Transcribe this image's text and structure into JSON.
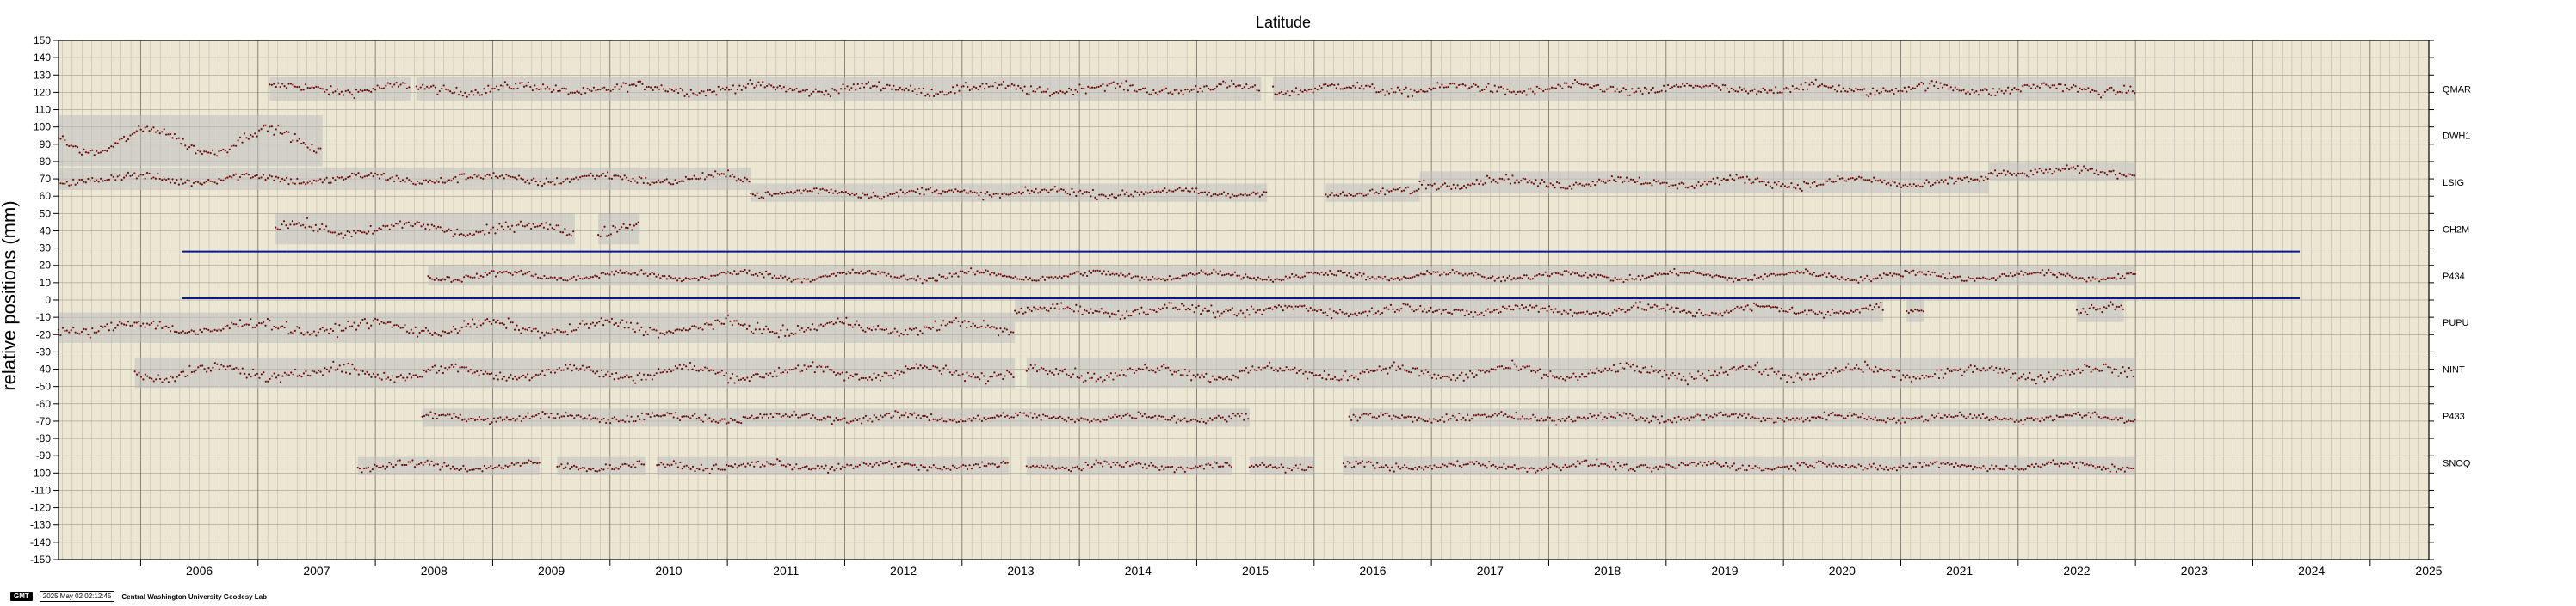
{
  "chart_data": {
    "type": "scatter",
    "title": "Latitude",
    "ylabel": "relative positions (mm)",
    "xlabel": "",
    "xlim": [
      2005.3,
      2025.5
    ],
    "ylim": [
      -150,
      150
    ],
    "x_ticks": [
      "2006",
      "2007",
      "2008",
      "2009",
      "2010",
      "2011",
      "2012",
      "2013",
      "2014",
      "2015",
      "2016",
      "2017",
      "2018",
      "2019",
      "2020",
      "2021",
      "2022",
      "2023",
      "2024",
      "2025"
    ],
    "y_ticks": [
      150,
      140,
      130,
      120,
      110,
      100,
      90,
      80,
      70,
      60,
      50,
      40,
      30,
      20,
      10,
      0,
      -10,
      -20,
      -30,
      -40,
      -50,
      -60,
      -70,
      -80,
      -90,
      -100,
      -110,
      -120,
      -130,
      -140,
      -150
    ],
    "grid": true,
    "background": "#ece7d2",
    "point_color": "#6e0f0f",
    "band_color": "#bdbdbd",
    "series": [
      {
        "name": "QMAR",
        "offset": 122,
        "amplitude": 2,
        "noise": 2.2,
        "segments": [
          [
            2007.1,
            2008.3
          ],
          [
            2008.35,
            2015.55
          ],
          [
            2015.65,
            2023.0
          ]
        ]
      },
      {
        "name": "DWH1",
        "offset": 92,
        "amplitude": 7,
        "noise": 2.2,
        "segments": [
          [
            2005.3,
            2007.55
          ]
        ]
      },
      {
        "name": "LSIG",
        "offset": 70,
        "amplitude": 2,
        "noise": 2.0,
        "segments": [
          [
            2005.3,
            2011.2
          ]
        ]
      },
      {
        "name": "LSIG",
        "offset": 62,
        "amplitude": 1.5,
        "noise": 1.8,
        "segments": [
          [
            2011.2,
            2015.6
          ],
          [
            2016.1,
            2016.9
          ]
        ]
      },
      {
        "name": "LSIG",
        "offset": 68,
        "amplitude": 2,
        "noise": 2.0,
        "segments": [
          [
            2016.9,
            2021.75
          ]
        ]
      },
      {
        "name": "LSIG",
        "offset": 74,
        "amplitude": 1.5,
        "noise": 1.8,
        "segments": [
          [
            2021.75,
            2023.0
          ]
        ]
      },
      {
        "name": "CH2M",
        "offset": 41,
        "amplitude": 3,
        "noise": 2.5,
        "segments": [
          [
            2007.15,
            2009.7
          ],
          [
            2009.9,
            2010.25
          ]
        ]
      },
      {
        "name": "P434",
        "offset": 14,
        "amplitude": 2,
        "noise": 1.5,
        "segments": [
          [
            2008.45,
            2020.1
          ],
          [
            2020.1,
            2023.0
          ]
        ]
      },
      {
        "name": "PUPU",
        "offset": -16,
        "amplitude": 3,
        "noise": 2.5,
        "segments": [
          [
            2005.3,
            2013.45
          ]
        ]
      },
      {
        "name": "PUPU",
        "offset": -6,
        "amplitude": 2,
        "noise": 2.2,
        "segments": [
          [
            2013.45,
            2020.85
          ],
          [
            2021.05,
            2021.2
          ],
          [
            2022.5,
            2022.9
          ]
        ]
      },
      {
        "name": "NINT",
        "offset": -42,
        "amplitude": 3,
        "noise": 2.5,
        "segments": [
          [
            2005.95,
            2013.45
          ],
          [
            2013.55,
            2023.0
          ]
        ]
      },
      {
        "name": "P433",
        "offset": -68,
        "amplitude": 1.5,
        "noise": 1.8,
        "segments": [
          [
            2008.4,
            2015.45
          ],
          [
            2016.3,
            2023.0
          ]
        ]
      },
      {
        "name": "SNOQ",
        "offset": -96,
        "amplitude": 1.5,
        "noise": 1.8,
        "segments": [
          [
            2007.85,
            2009.4
          ],
          [
            2009.55,
            2010.3
          ],
          [
            2010.4,
            2013.4
          ],
          [
            2013.55,
            2015.3
          ],
          [
            2015.45,
            2016.0
          ],
          [
            2016.25,
            2023.0
          ]
        ]
      }
    ],
    "station_labels": [
      {
        "name": "QMAR",
        "y": 122
      },
      {
        "name": "DWH1",
        "y": 95
      },
      {
        "name": "LSIG",
        "y": 68
      },
      {
        "name": "CH2M",
        "y": 41
      },
      {
        "name": "P434",
        "y": 14
      },
      {
        "name": "PUPU",
        "y": -13
      },
      {
        "name": "NINT",
        "y": -40
      },
      {
        "name": "P433",
        "y": -67
      },
      {
        "name": "SNOQ",
        "y": -94
      }
    ],
    "reference_lines": [
      {
        "y": 28,
        "x_start": 2006.35,
        "x_end": 2024.4,
        "color": "#0a1a8c"
      },
      {
        "y": 1,
        "x_start": 2006.35,
        "x_end": 2024.4,
        "color": "#0a1a8c"
      }
    ]
  },
  "footer": {
    "logo": "GMT",
    "timestamp": "2025 May 02 02:12:45",
    "credit": "Central Washington University Geodesy Lab"
  }
}
